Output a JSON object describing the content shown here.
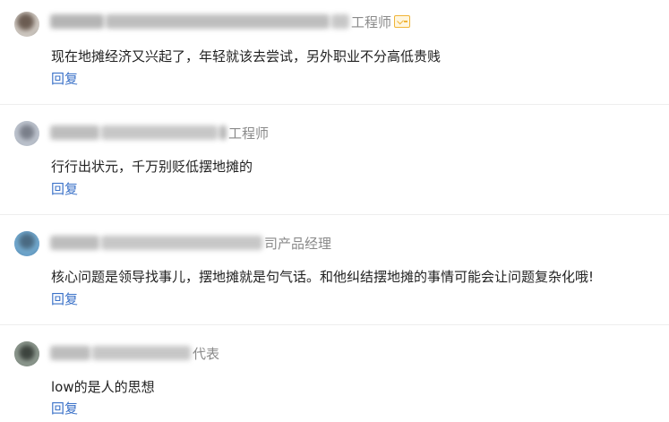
{
  "comments": [
    {
      "author_suffix": "工程师",
      "has_vip_badge": true,
      "text": "现在地摊经济又兴起了，年轻就该去尝试，另外职业不分高低贵贱",
      "reply_label": "回复"
    },
    {
      "author_suffix": "工程师",
      "has_vip_badge": false,
      "text": "行行出状元，千万别贬低摆地摊的",
      "reply_label": "回复"
    },
    {
      "author_suffix": "司产品经理",
      "has_vip_badge": false,
      "text": "核心问题是领导找事儿，摆地摊就是句气话。和他纠结摆地摊的事情可能会让问题复杂化哦!",
      "reply_label": "回复"
    },
    {
      "author_suffix": "代表",
      "has_vip_badge": false,
      "text": "low的是人的思想",
      "reply_label": "回复"
    }
  ],
  "colors": {
    "reply_link": "#3b72c8",
    "meta_text": "#8a8a8a",
    "body_text": "#222222",
    "vip_badge": "#f0b437",
    "divider": "#eeeeee"
  },
  "icons": {
    "vip_badge": "vip-badge-icon"
  }
}
